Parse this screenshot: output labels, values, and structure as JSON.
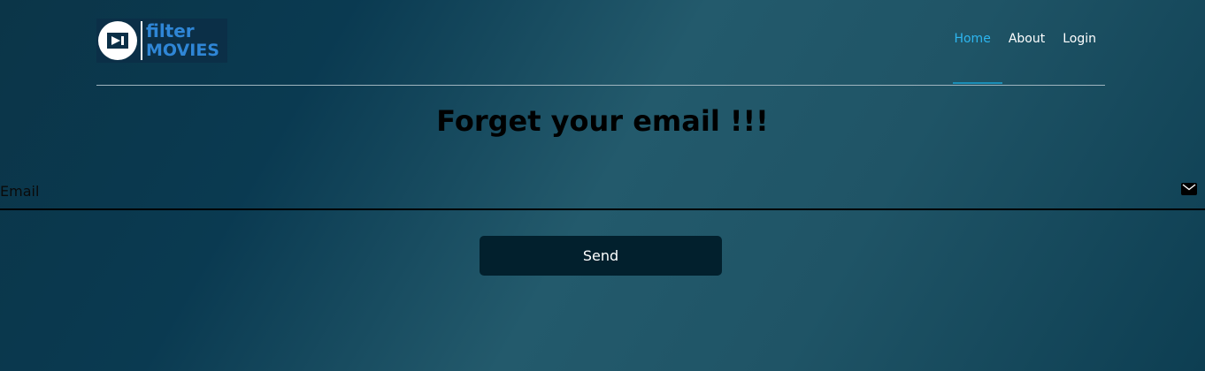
{
  "logo": {
    "line1": "filter",
    "line2": "MOVIES",
    "icon": "play-arrow-icon"
  },
  "nav": {
    "items": [
      {
        "label": "Home",
        "active": true
      },
      {
        "label": "About",
        "active": false
      },
      {
        "label": "Login",
        "active": false
      }
    ],
    "active_color": "#2db6f0"
  },
  "heading": "Forget your email !!!",
  "email": {
    "placeholder": "Email",
    "value": "",
    "icon": "envelope-icon"
  },
  "send_button": {
    "label": "Send"
  },
  "colors": {
    "button_bg": "#02202d",
    "logo_text": "#2f86d6"
  }
}
